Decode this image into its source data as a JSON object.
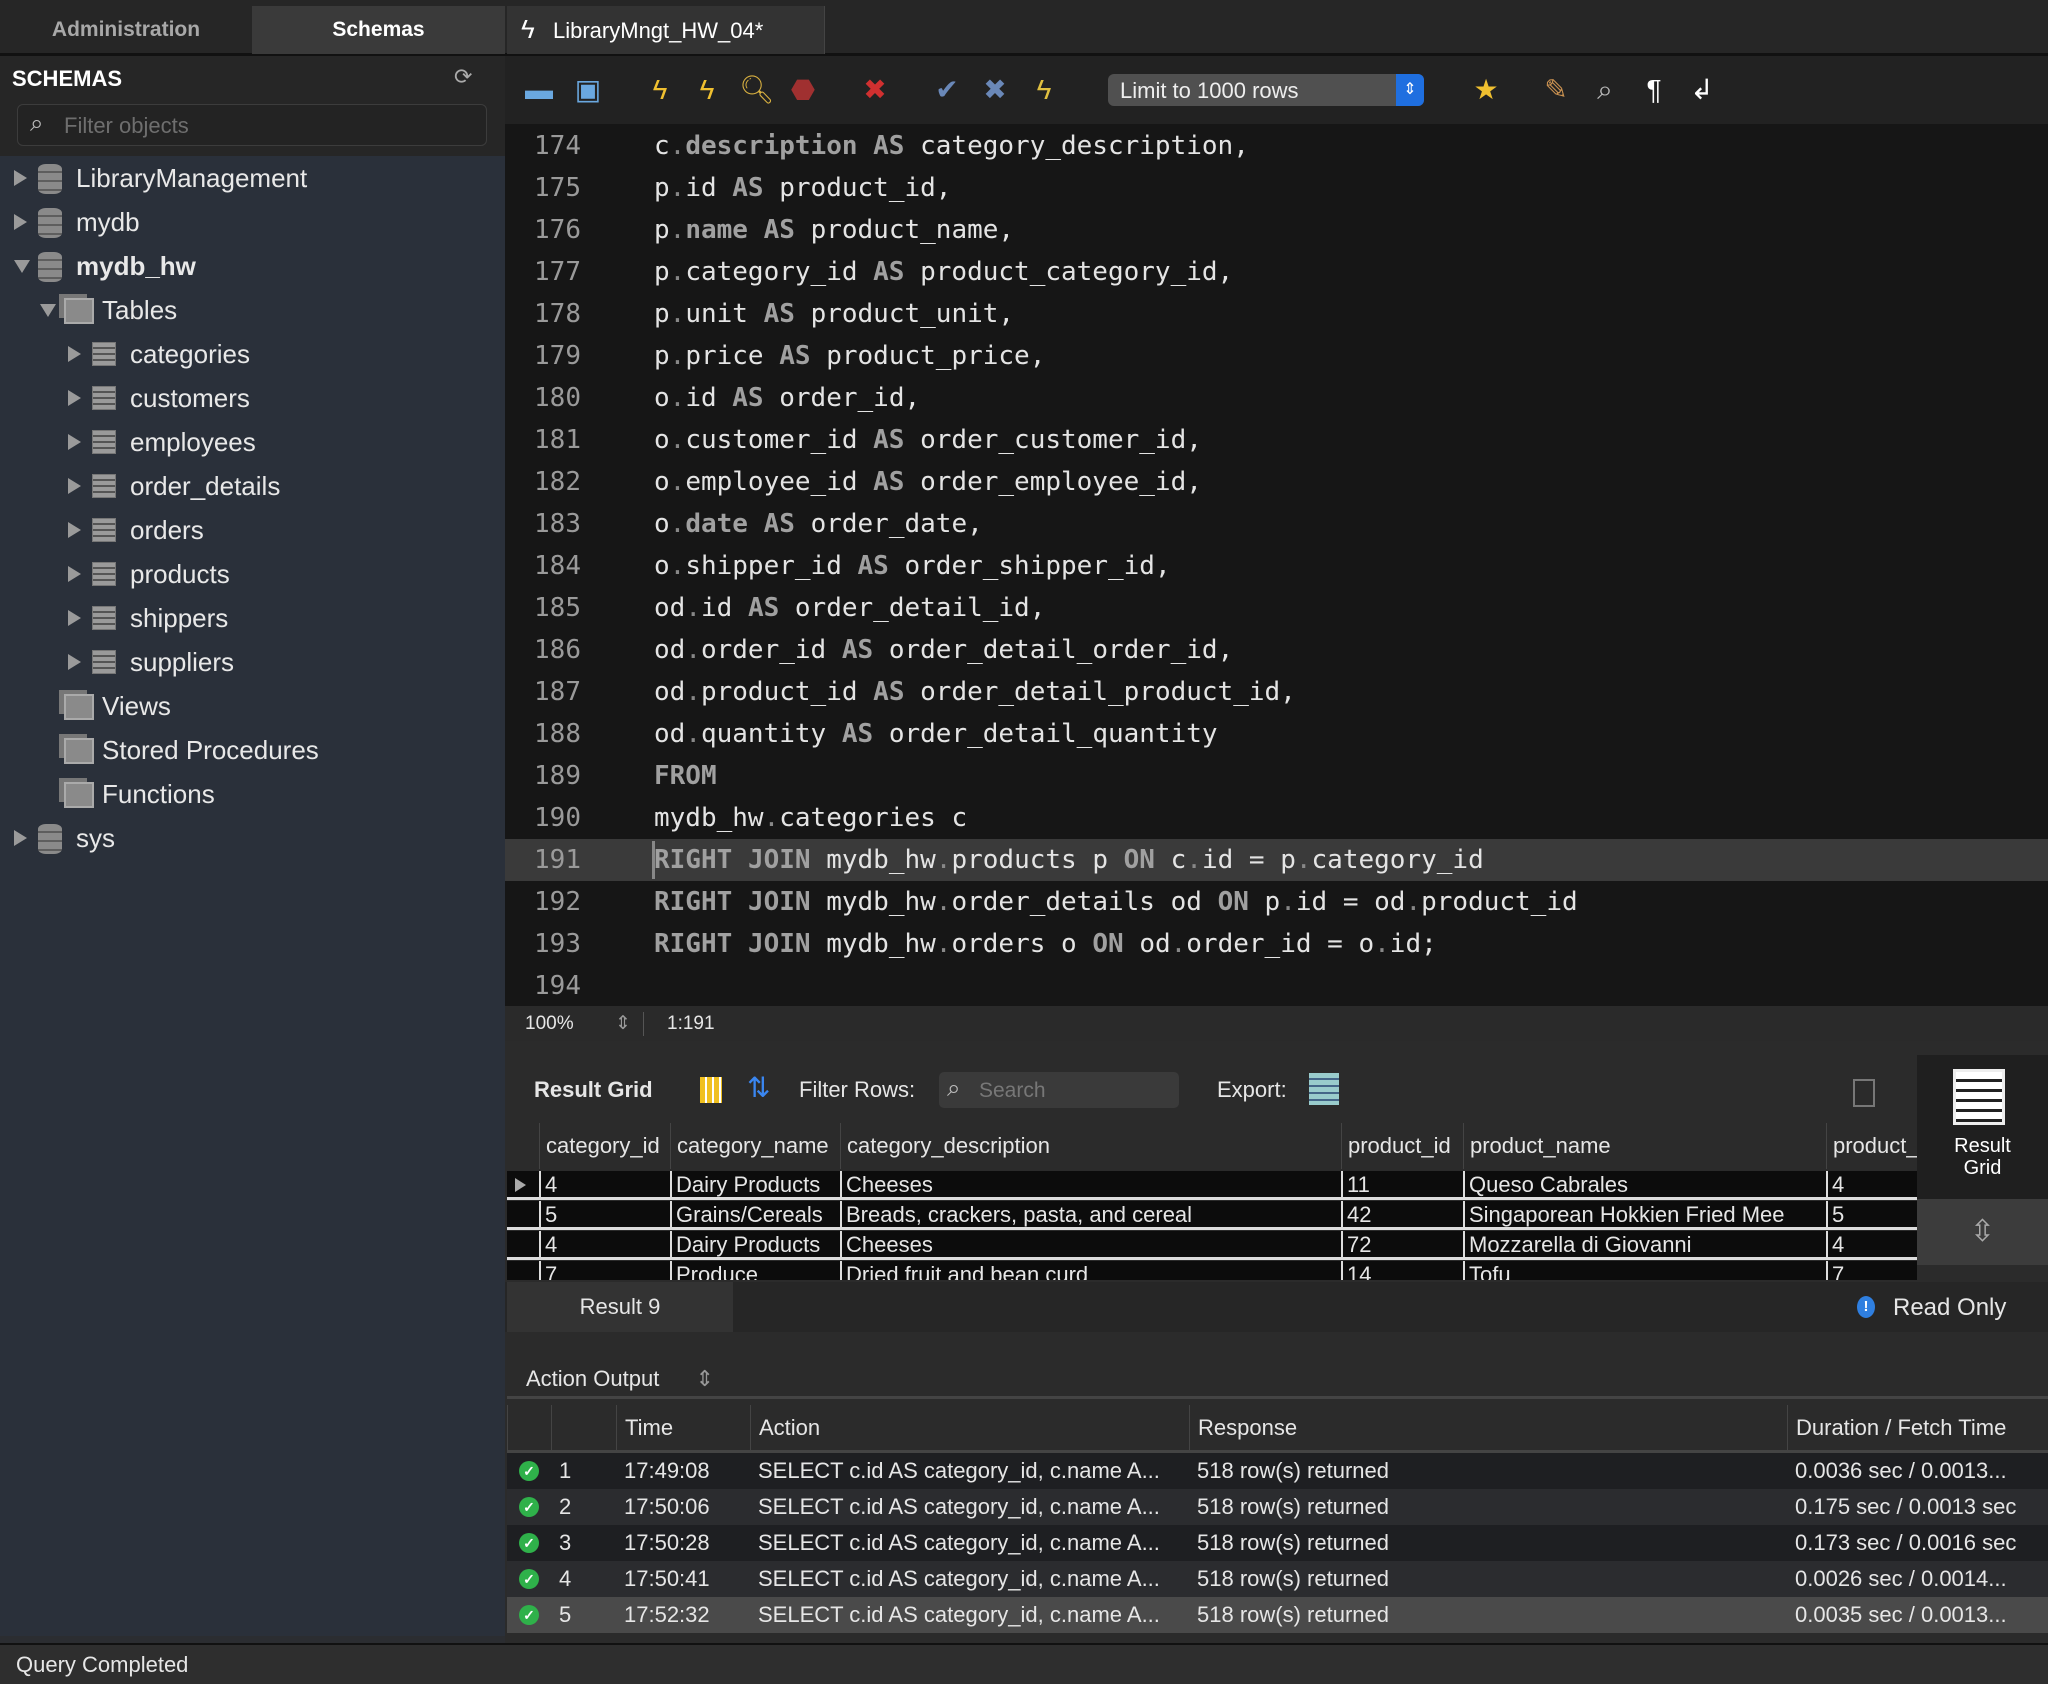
{
  "sidebar": {
    "tabs": [
      {
        "label": "Administration"
      },
      {
        "label": "Schemas"
      }
    ],
    "title": "SCHEMAS",
    "filter_placeholder": "Filter objects",
    "tree": [
      {
        "label": "LibraryManagement",
        "level": 0,
        "type": "db",
        "state": "collapsed"
      },
      {
        "label": "mydb",
        "level": 0,
        "type": "db",
        "state": "collapsed"
      },
      {
        "label": "mydb_hw",
        "level": 0,
        "type": "db",
        "state": "expanded",
        "bold": true
      },
      {
        "label": "Tables",
        "level": 1,
        "type": "group",
        "state": "expanded"
      },
      {
        "label": "categories",
        "level": 2,
        "type": "table",
        "state": "collapsed"
      },
      {
        "label": "customers",
        "level": 2,
        "type": "table",
        "state": "collapsed"
      },
      {
        "label": "employees",
        "level": 2,
        "type": "table",
        "state": "collapsed"
      },
      {
        "label": "order_details",
        "level": 2,
        "type": "table",
        "state": "collapsed"
      },
      {
        "label": "orders",
        "level": 2,
        "type": "table",
        "state": "collapsed"
      },
      {
        "label": "products",
        "level": 2,
        "type": "table",
        "state": "collapsed"
      },
      {
        "label": "shippers",
        "level": 2,
        "type": "table",
        "state": "collapsed"
      },
      {
        "label": "suppliers",
        "level": 2,
        "type": "table",
        "state": "collapsed"
      },
      {
        "label": "Views",
        "level": 1,
        "type": "group",
        "state": "none"
      },
      {
        "label": "Stored Procedures",
        "level": 1,
        "type": "group",
        "state": "none"
      },
      {
        "label": "Functions",
        "level": 1,
        "type": "group",
        "state": "none"
      },
      {
        "label": "sys",
        "level": 0,
        "type": "db",
        "state": "collapsed"
      }
    ]
  },
  "editor": {
    "tab_label": "LibraryMngt_HW_04*",
    "limit_select": "Limit to 1000 rows",
    "toolbar_icons": [
      "open-folder-icon",
      "save-icon",
      "execute-icon",
      "execute-current-icon",
      "explain-icon",
      "stop-icon",
      "toggle-error-icon",
      "commit-icon",
      "rollback-icon",
      "autocommit-icon",
      "bookmark-star-icon",
      "beautify-icon",
      "find-icon",
      "invisible-chars-icon",
      "wrap-icon"
    ],
    "lines": [
      {
        "n": "174",
        "t": "c.description AS category_description,"
      },
      {
        "n": "175",
        "t": "p.id AS product_id,"
      },
      {
        "n": "176",
        "t": "p.name AS product_name,"
      },
      {
        "n": "177",
        "t": "p.category_id AS product_category_id,"
      },
      {
        "n": "178",
        "t": "p.unit AS product_unit,"
      },
      {
        "n": "179",
        "t": "p.price AS product_price,"
      },
      {
        "n": "180",
        "t": "o.id AS order_id,"
      },
      {
        "n": "181",
        "t": "o.customer_id AS order_customer_id,"
      },
      {
        "n": "182",
        "t": "o.employee_id AS order_employee_id,"
      },
      {
        "n": "183",
        "t": "o.date AS order_date,"
      },
      {
        "n": "184",
        "t": "o.shipper_id AS order_shipper_id,"
      },
      {
        "n": "185",
        "t": "od.id AS order_detail_id,"
      },
      {
        "n": "186",
        "t": "od.order_id AS order_detail_order_id,"
      },
      {
        "n": "187",
        "t": "od.product_id AS order_detail_product_id,"
      },
      {
        "n": "188",
        "t": "od.quantity AS order_detail_quantity"
      },
      {
        "n": "189",
        "t": "FROM"
      },
      {
        "n": "190",
        "t": "mydb_hw.categories c"
      },
      {
        "n": "191",
        "t": "RIGHT JOIN mydb_hw.products p ON c.id = p.category_id",
        "current": true
      },
      {
        "n": "192",
        "t": "RIGHT JOIN mydb_hw.order_details od ON p.id = od.product_id"
      },
      {
        "n": "193",
        "t": "RIGHT JOIN mydb_hw.orders o ON od.order_id = o.id;"
      },
      {
        "n": "194",
        "t": ""
      }
    ],
    "keywords": [
      "AS",
      "FROM",
      "RIGHT",
      "JOIN",
      "ON",
      "name",
      "date",
      "description"
    ],
    "zoom": "100%",
    "cursor": "1:191"
  },
  "results": {
    "title": "Result Grid",
    "filter_label": "Filter Rows:",
    "search_placeholder": "Search",
    "export_label": "Export:",
    "side_label": "Result Grid",
    "tab_label": "Result 9",
    "read_only": "Read Only",
    "columns": [
      "category_id",
      "category_name",
      "category_description",
      "product_id",
      "product_name",
      "product_"
    ],
    "rows": [
      [
        "4",
        "Dairy Products",
        "Cheeses",
        "11",
        "Queso Cabrales",
        "4"
      ],
      [
        "5",
        "Grains/Cereals",
        "Breads, crackers, pasta, and cereal",
        "42",
        "Singaporean Hokkien Fried Mee",
        "5"
      ],
      [
        "4",
        "Dairy Products",
        "Cheeses",
        "72",
        "Mozzarella di Giovanni",
        "4"
      ],
      [
        "7",
        "Produce",
        "Dried fruit and bean curd",
        "14",
        "Tofu",
        "7"
      ]
    ]
  },
  "action_output": {
    "label": "Action Output",
    "columns": [
      "",
      "",
      "Time",
      "Action",
      "Response",
      "Duration / Fetch Time"
    ],
    "rows": [
      [
        "1",
        "17:49:08",
        "SELECT c.id AS category_id, c.name A...",
        "518 row(s) returned",
        "0.0036 sec / 0.0013..."
      ],
      [
        "2",
        "17:50:06",
        "SELECT c.id AS category_id, c.name A...",
        "518 row(s) returned",
        "0.175 sec / 0.0013 sec"
      ],
      [
        "3",
        "17:50:28",
        "SELECT c.id AS category_id, c.name A...",
        "518 row(s) returned",
        "0.173 sec / 0.0016 sec"
      ],
      [
        "4",
        "17:50:41",
        "SELECT c.id AS category_id, c.name A...",
        "518 row(s) returned",
        "0.0026 sec / 0.0014..."
      ],
      [
        "5",
        "17:52:32",
        "SELECT c.id AS category_id, c.name A...",
        "518 row(s) returned",
        "0.0035 sec / 0.0013..."
      ]
    ]
  },
  "status": "Query Completed",
  "colors": {
    "accent": "#1f6fe0",
    "success": "#2fb14a"
  }
}
